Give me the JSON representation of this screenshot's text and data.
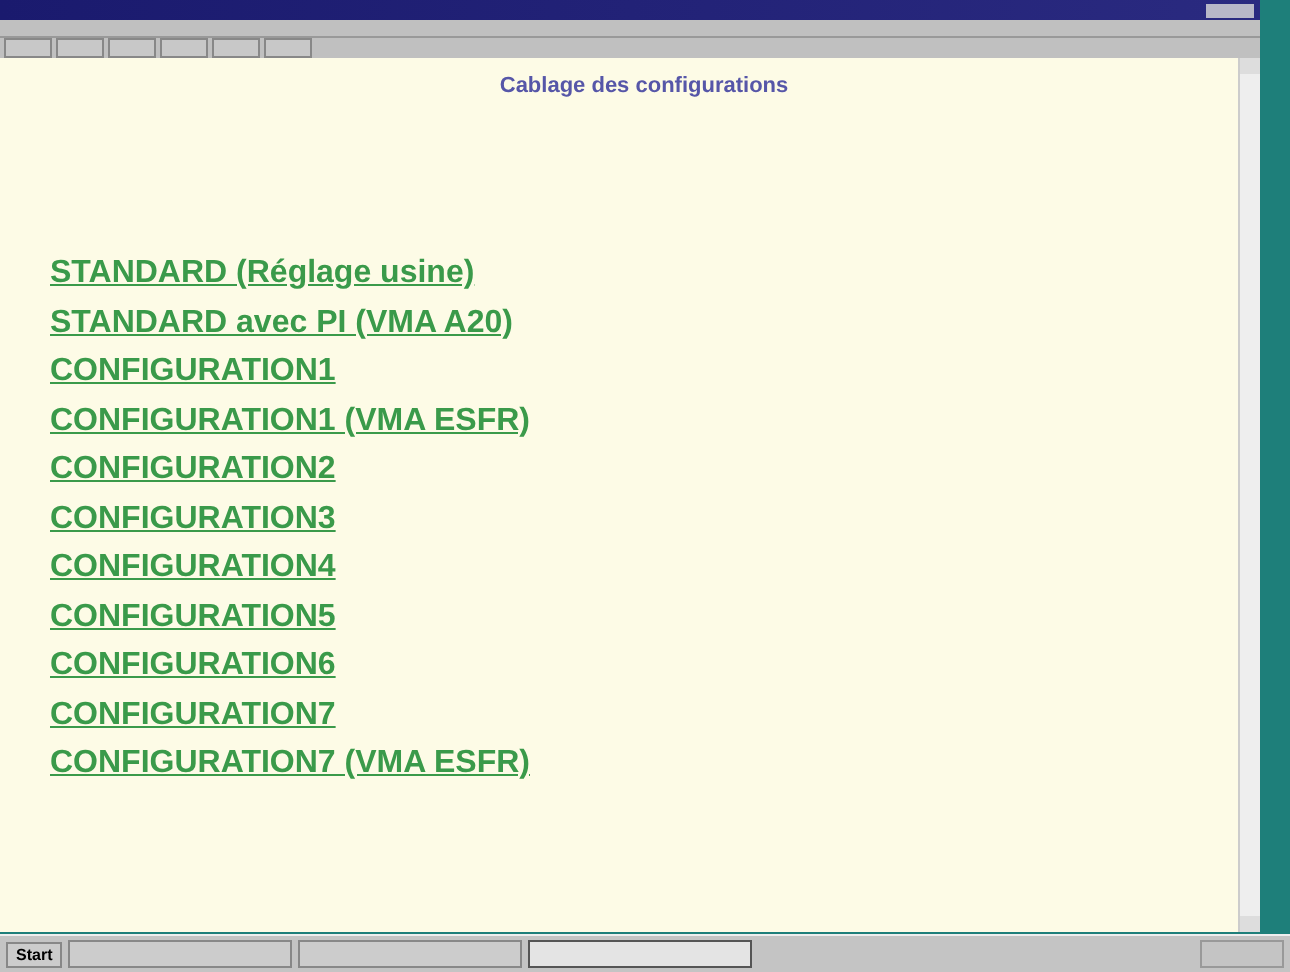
{
  "heading": "Cablage des configurations",
  "links": [
    "STANDARD (Réglage usine)",
    "STANDARD avec PI (VMA A20)",
    "CONFIGURATION1",
    "CONFIGURATION1 (VMA ESFR)",
    "CONFIGURATION2",
    "CONFIGURATION3",
    "CONFIGURATION4",
    "CONFIGURATION5",
    "CONFIGURATION6",
    "CONFIGURATION7",
    "CONFIGURATION7 (VMA ESFR)"
  ],
  "taskbar": {
    "start": "Start",
    "tasks": [
      {
        "selected": false
      },
      {
        "selected": false
      },
      {
        "selected": true
      }
    ]
  }
}
